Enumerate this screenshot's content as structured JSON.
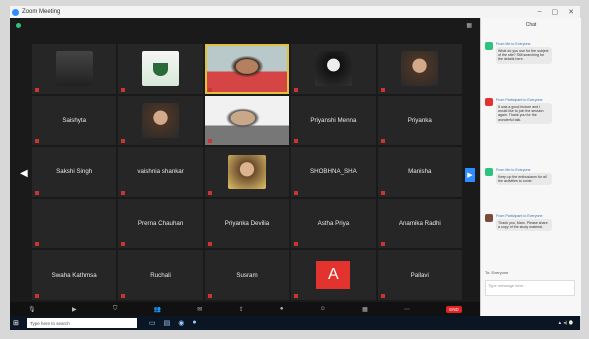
{
  "window": {
    "title": "Zoom Meeting"
  },
  "participants": [
    {
      "name": "",
      "kind": "photo-dark"
    },
    {
      "name": "",
      "kind": "photo-green"
    },
    {
      "name": "",
      "kind": "video-red",
      "speaking": true
    },
    {
      "name": "",
      "kind": "photo-bw"
    },
    {
      "name": "",
      "kind": "photo-brown"
    },
    {
      "name": "Saishyta",
      "kind": "name"
    },
    {
      "name": "",
      "kind": "photo-brown"
    },
    {
      "name": "",
      "kind": "video-gray"
    },
    {
      "name": "Priyanshi Menna",
      "kind": "name"
    },
    {
      "name": "Priyanka",
      "kind": "name"
    },
    {
      "name": "Sakshi Singh",
      "kind": "name"
    },
    {
      "name": "vaishnia shankar",
      "kind": "name"
    },
    {
      "name": "",
      "kind": "photo-yellow"
    },
    {
      "name": "SHOBHNA_SHA",
      "kind": "name"
    },
    {
      "name": "Manisha",
      "kind": "name"
    },
    {
      "name": "",
      "kind": "blank"
    },
    {
      "name": "Prerna Chauhan",
      "kind": "name"
    },
    {
      "name": "Priyanka Devilia",
      "kind": "name"
    },
    {
      "name": "Astha Priya",
      "kind": "name"
    },
    {
      "name": "Anamika Radhi",
      "kind": "name"
    },
    {
      "name": "Swaha Kathmsa",
      "kind": "name"
    },
    {
      "name": "Ruchali",
      "kind": "name"
    },
    {
      "name": "Susram",
      "kind": "name"
    },
    {
      "name": "A",
      "kind": "avatar"
    },
    {
      "name": "Pallavi",
      "kind": "name"
    }
  ],
  "chat": {
    "title": "Chat",
    "to_label": "To: Everyone",
    "input_placeholder": "Type message here...",
    "messages": [
      {
        "from": "From Me to Everyone",
        "text": "What do you use for the subject of the site? Still searching for the details here.",
        "color": "#2ec27e"
      },
      {
        "from": "From Participant to Everyone",
        "text": "It was a good lecture and I would like to join the session again. Thank you for the wonderful talk.",
        "color": "#e2332f"
      },
      {
        "from": "From Me to Everyone",
        "text": "Keep up the enthusiasm for all the activities to come.",
        "color": "#2ec27e"
      },
      {
        "from": "From Participant to Everyone",
        "text": "Thank you, Mam. Please share a copy of the study material.",
        "color": "#7a4b3a"
      }
    ]
  },
  "taskbar": {
    "search_placeholder": "Type here to search"
  }
}
